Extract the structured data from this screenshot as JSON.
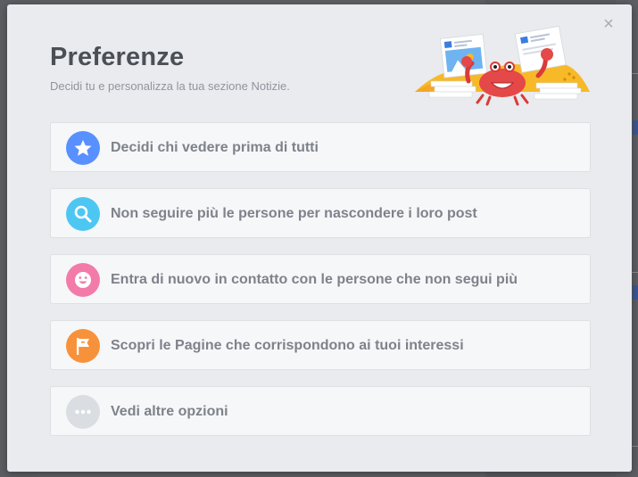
{
  "modal": {
    "close_label": "×",
    "title": "Preferenze",
    "subtitle": "Decidi tu e personalizza la tua sezione Notizie."
  },
  "options": [
    {
      "label": "Decidi chi vedere prima di tutti",
      "icon": "star-icon",
      "color": "#5890ff"
    },
    {
      "label": "Non seguire più le persone per nascondere i loro post",
      "icon": "search-icon",
      "color": "#4dc7f2"
    },
    {
      "label": "Entra di nuovo in contatto con le persone che non segui più",
      "icon": "smiley-icon",
      "color": "#f37ba9"
    },
    {
      "label": "Scopri le Pagine che corrispondono ai tuoi interessi",
      "icon": "flag-icon",
      "color": "#f7923b"
    },
    {
      "label": "Vedi altre opzioni",
      "icon": "more-icon",
      "color": "#dadde1"
    }
  ]
}
